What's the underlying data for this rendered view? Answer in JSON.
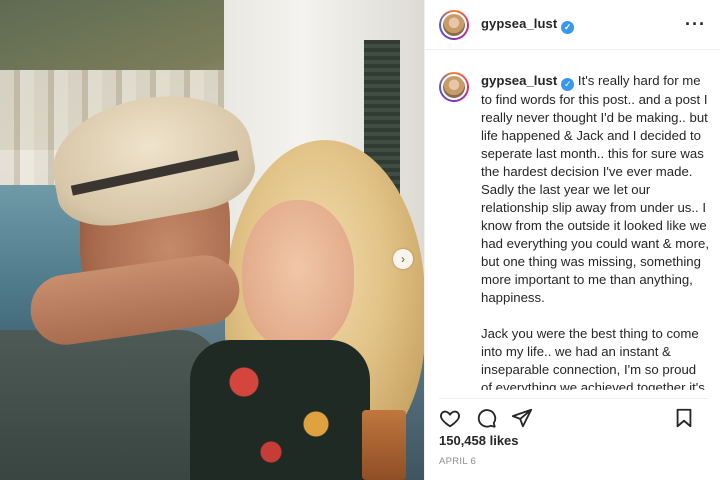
{
  "post": {
    "username": "gypsea_lust",
    "verified_symbol": "✓",
    "more_symbol": "···",
    "caption_paragraphs": [
      "It's really hard for me to find words for this post.. and a post I really never thought I'd be making.. but life happened & Jack and I decided to seperate last month.. this for sure was the hardest decision I've ever made.\nSadly the last year we let our relationship slip away from under us.. I know from the outside it looked like we had everything you could want & more, but one thing was missing, something more important to me than anything, happiness.",
      "Jack you were the best thing to come into my life.. we had an instant & inseparable connection, I'm so proud of everything we achieved together it's more than I could have ever"
    ],
    "likes": "150,458 likes",
    "date": "APRIL 6"
  },
  "icons": {
    "like": "heart-icon",
    "comment": "comment-icon",
    "share": "paper-plane-icon",
    "save": "bookmark-icon",
    "carousel_next": "chevron-right-icon"
  },
  "colors": {
    "verified": "#3897f0",
    "text": "#262626",
    "muted": "#8e8e8e"
  }
}
